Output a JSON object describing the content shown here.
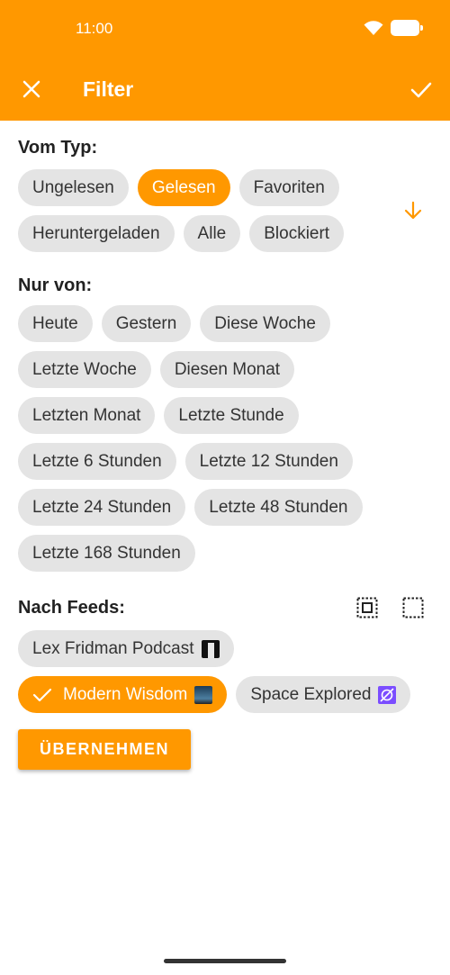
{
  "status_bar": {
    "time": "11:00"
  },
  "appbar": {
    "title": "Filter"
  },
  "sections": {
    "type": {
      "title": "Vom Typ:",
      "rows": [
        [
          {
            "label": "Ungelesen",
            "selected": false
          },
          {
            "label": "Gelesen",
            "selected": true
          },
          {
            "label": "Favoriten",
            "selected": false
          }
        ],
        [
          {
            "label": "Heruntergeladen",
            "selected": false
          },
          {
            "label": "Alle",
            "selected": false
          },
          {
            "label": "Blockiert",
            "selected": false
          }
        ]
      ]
    },
    "time": {
      "title": "Nur von:",
      "rows": [
        [
          {
            "label": "Heute"
          },
          {
            "label": "Gestern"
          },
          {
            "label": "Diese Woche"
          }
        ],
        [
          {
            "label": "Letzte Woche"
          },
          {
            "label": "Diesen Monat"
          }
        ],
        [
          {
            "label": "Letzten Monat"
          },
          {
            "label": "Letzte Stunde"
          }
        ],
        [
          {
            "label": "Letzte 6 Stunden"
          },
          {
            "label": "Letzte 12 Stunden"
          }
        ],
        [
          {
            "label": "Letzte 24 Stunden"
          },
          {
            "label": "Letzte 48 Stunden"
          }
        ],
        [
          {
            "label": "Letzte 168 Stunden"
          }
        ]
      ]
    },
    "feeds": {
      "title": "Nach Feeds:",
      "rows": [
        [
          {
            "label": "Lex Fridman Podcast",
            "selected": false,
            "icon": "lex-fridman-thumbnail-icon"
          }
        ],
        [
          {
            "label": "Modern Wisdom",
            "selected": true,
            "icon": "modern-wisdom-thumbnail-icon"
          },
          {
            "label": "Space Explored",
            "selected": false,
            "icon": "space-explored-thumbnail-icon"
          }
        ]
      ]
    }
  },
  "apply_button": {
    "label": "ÜBERNEHMEN"
  },
  "colors": {
    "accent": "#FF9800",
    "chip_bg": "#E4E4E4",
    "chip_text": "#333333"
  }
}
